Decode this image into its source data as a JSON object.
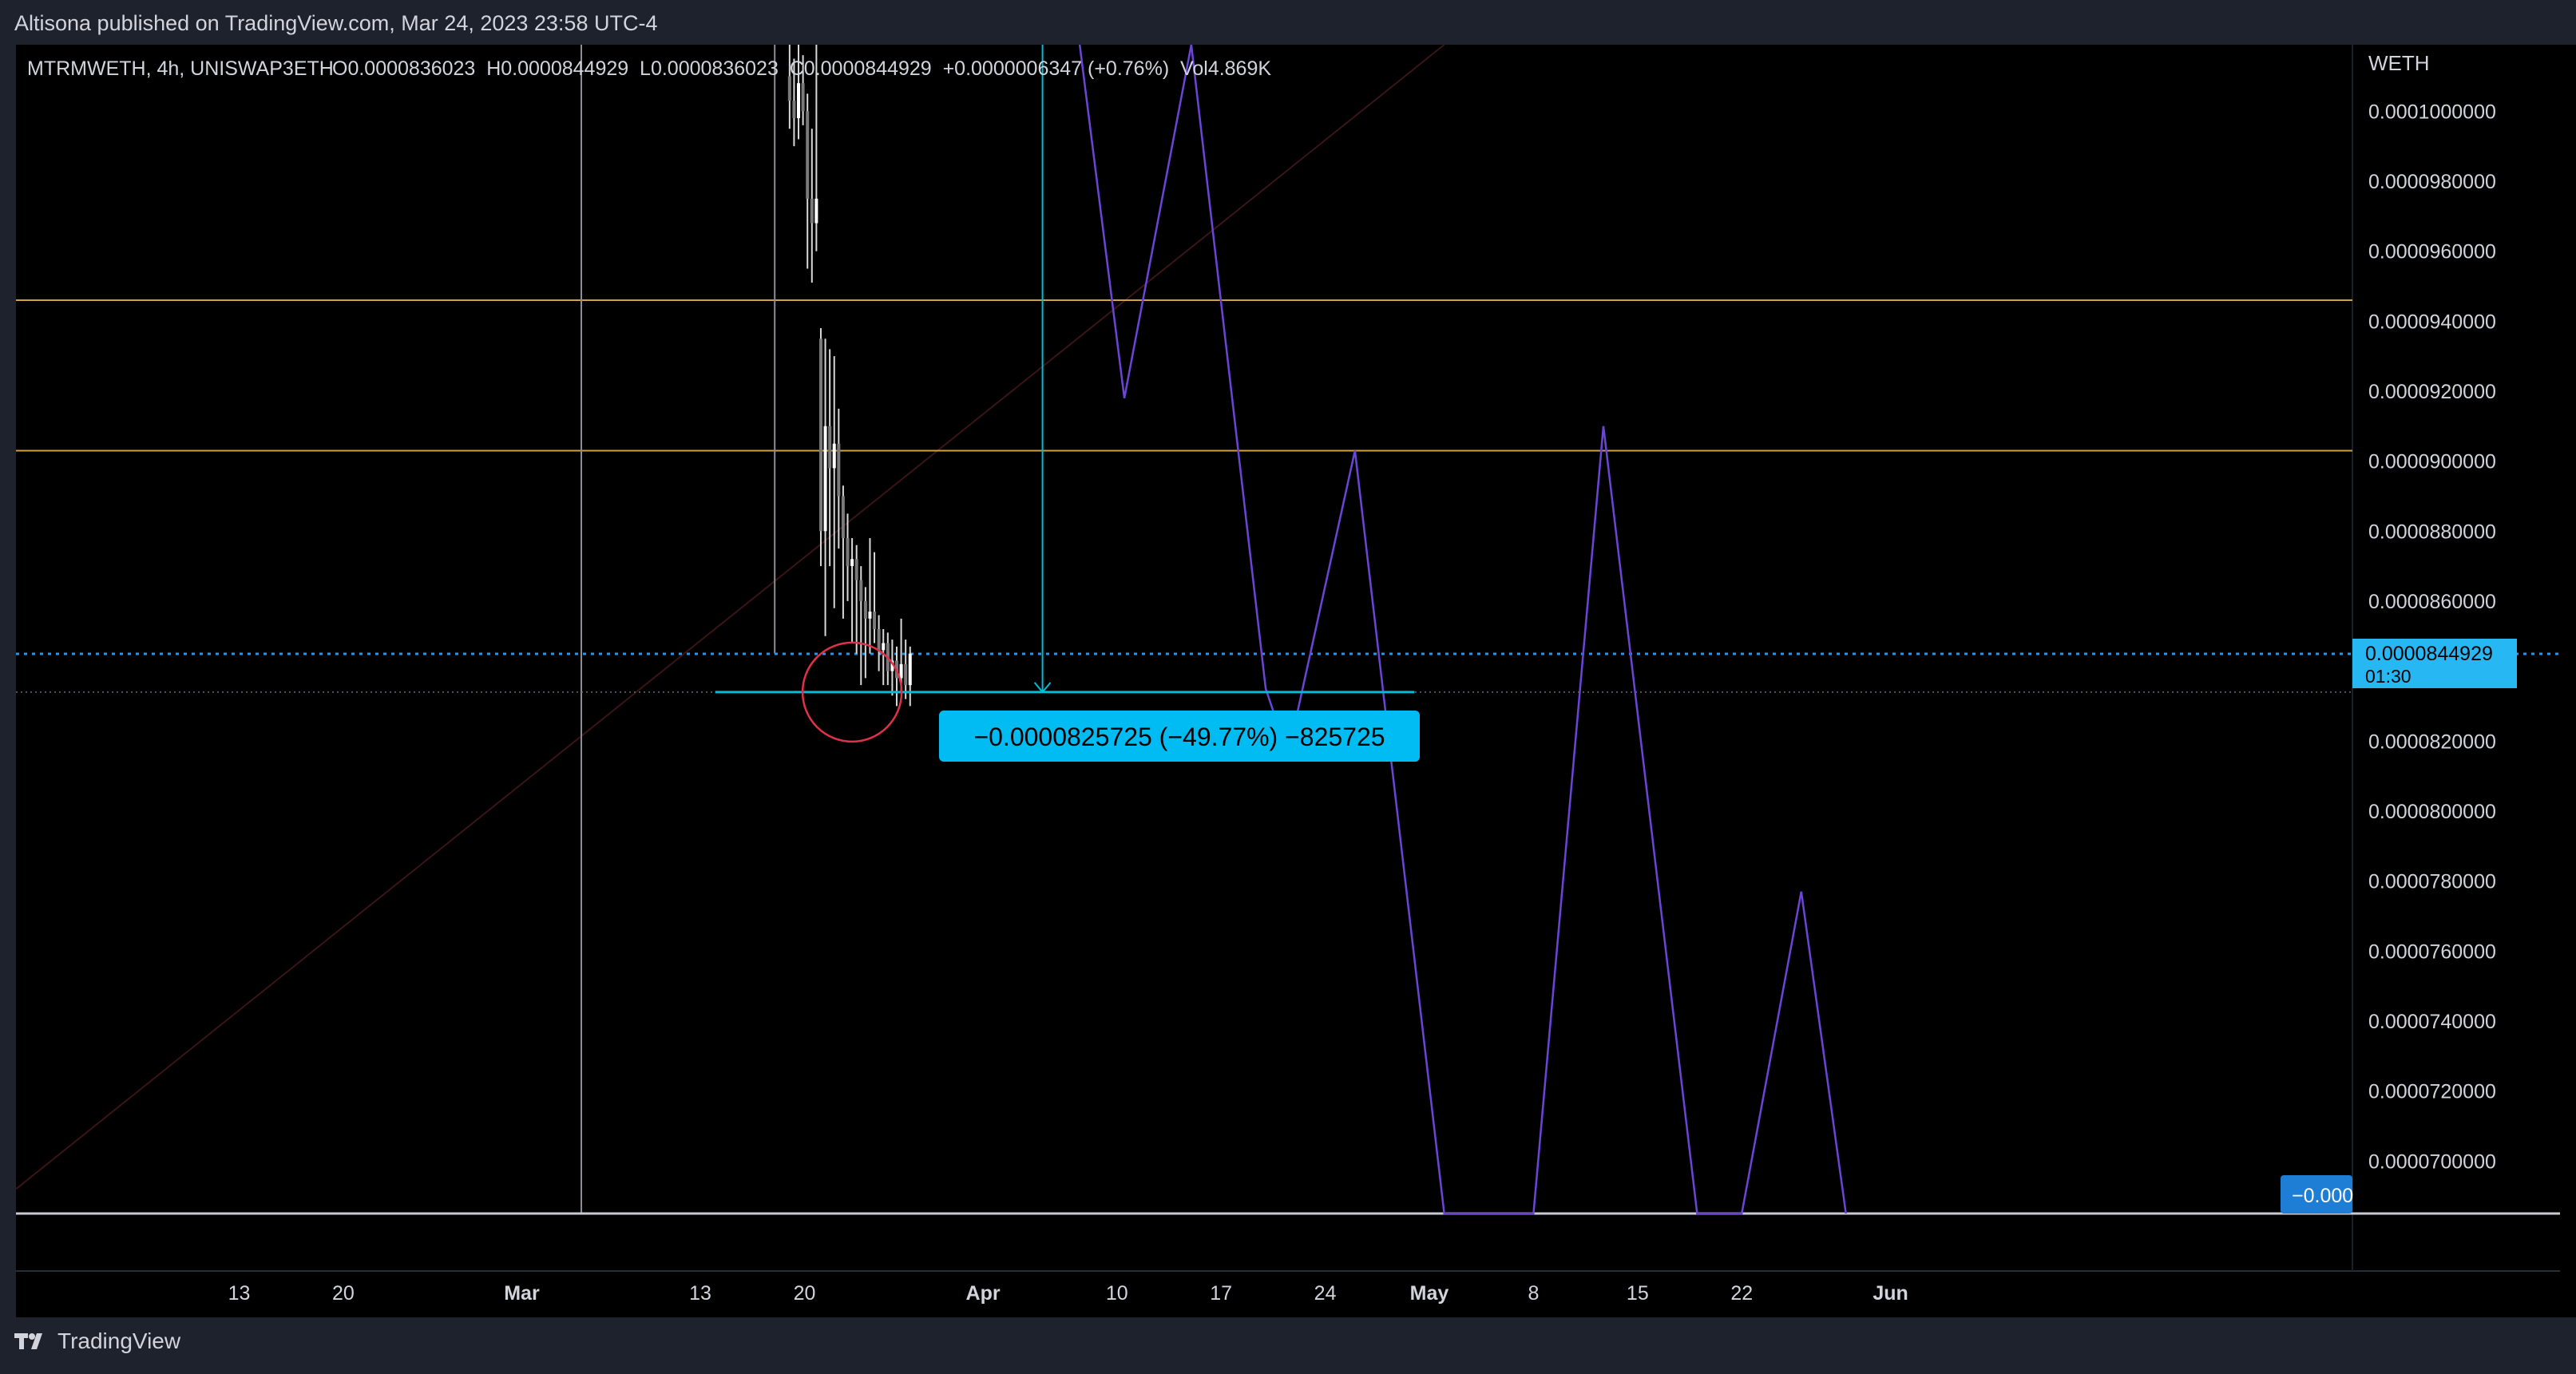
{
  "header": {
    "publish_line": "Altisona published on TradingView.com, Mar 24, 2023 23:58 UTC-4"
  },
  "legend": {
    "symbol": "MTRMWETH, 4h, UNISWAP3ETH",
    "ohlc": "O0.0000836023  H0.0000844929  L0.0000836023  C0.0000844929  +0.0000006347 (+0.76%)  Vol4.869K"
  },
  "footer": {
    "brand": "TradingView",
    "logo_icon": "tradingview-logo-icon"
  },
  "chart_data": {
    "type": "candlestick",
    "y_unit": "WETH",
    "ylim": [
      6.85e-05,
      0.0001019
    ],
    "y_ticks": [
      "0.0001000000",
      "0.0000980000",
      "0.0000960000",
      "0.0000940000",
      "0.0000920000",
      "0.0000900000",
      "0.0000880000",
      "0.0000860000",
      "0.0000820000",
      "0.0000800000",
      "0.0000780000",
      "0.0000760000",
      "0.0000740000",
      "0.0000720000",
      "0.0000700000"
    ],
    "x_day_range": [
      -34,
      137
    ],
    "x_ticks": [
      {
        "label": "13",
        "day": -19
      },
      {
        "label": "20",
        "day": -12
      },
      {
        "label": "Mar",
        "day": 0
      },
      {
        "label": "13",
        "day": 12
      },
      {
        "label": "20",
        "day": 19
      },
      {
        "label": "Apr",
        "day": 31
      },
      {
        "label": "10",
        "day": 40
      },
      {
        "label": "17",
        "day": 47
      },
      {
        "label": "24",
        "day": 54
      },
      {
        "label": "May",
        "day": 61
      },
      {
        "label": "8",
        "day": 68
      },
      {
        "label": "15",
        "day": 75
      },
      {
        "label": "22",
        "day": 82
      },
      {
        "label": "Jun",
        "day": 92
      }
    ],
    "price_label": {
      "value": "0.0000844929",
      "countdown": "01:30",
      "price": 8.44929e-05
    },
    "bottom_badge": "−0.000",
    "measure_label": "−0.0000825725 (−49.77%) −825725",
    "candles": [
      {
        "x": 18.0,
        "o": 0.000101,
        "c": 0.0001003,
        "h": 0.0001019,
        "l": 9.95e-05
      },
      {
        "x": 18.3,
        "o": 0.0001003,
        "c": 9.98e-05,
        "h": 0.0001015,
        "l": 9.9e-05
      },
      {
        "x": 18.6,
        "o": 9.98e-05,
        "c": 0.0001008,
        "h": 0.0001019,
        "l": 9.92e-05
      },
      {
        "x": 18.9,
        "o": 0.0001008,
        "c": 0.0001,
        "h": 0.0001016,
        "l": 9.96e-05
      },
      {
        "x": 19.2,
        "o": 0.0001,
        "c": 9.75e-05,
        "h": 0.0001005,
        "l": 9.55e-05
      },
      {
        "x": 19.5,
        "o": 9.75e-05,
        "c": 9.68e-05,
        "h": 9.95e-05,
        "l": 9.51e-05
      },
      {
        "x": 19.8,
        "o": 9.68e-05,
        "c": 9.75e-05,
        "h": 0.0001019,
        "l": 9.6e-05
      },
      {
        "x": 20.1,
        "o": 9.35e-05,
        "c": 8.8e-05,
        "h": 9.38e-05,
        "l": 8.7e-05
      },
      {
        "x": 20.4,
        "o": 8.8e-05,
        "c": 9.1e-05,
        "h": 9.35e-05,
        "l": 8.5e-05
      },
      {
        "x": 20.7,
        "o": 9.1e-05,
        "c": 8.98e-05,
        "h": 9.32e-05,
        "l": 8.7e-05
      },
      {
        "x": 21.0,
        "o": 8.98e-05,
        "c": 9.05e-05,
        "h": 9.3e-05,
        "l": 8.58e-05
      },
      {
        "x": 21.3,
        "o": 9.05e-05,
        "c": 8.9e-05,
        "h": 9.15e-05,
        "l": 8.75e-05
      },
      {
        "x": 21.6,
        "o": 8.9e-05,
        "c": 8.78e-05,
        "h": 8.93e-05,
        "l": 8.55e-05
      },
      {
        "x": 21.9,
        "o": 8.78e-05,
        "c": 8.7e-05,
        "h": 8.85e-05,
        "l": 8.6e-05
      },
      {
        "x": 22.2,
        "o": 8.7e-05,
        "c": 8.72e-05,
        "h": 8.78e-05,
        "l": 8.48e-05
      },
      {
        "x": 22.5,
        "o": 8.72e-05,
        "c": 8.66e-05,
        "h": 8.76e-05,
        "l": 8.45e-05
      },
      {
        "x": 22.8,
        "o": 8.66e-05,
        "c": 8.6e-05,
        "h": 8.7e-05,
        "l": 8.36e-05
      },
      {
        "x": 23.1,
        "o": 8.6e-05,
        "c": 8.55e-05,
        "h": 8.64e-05,
        "l": 8.38e-05
      },
      {
        "x": 23.4,
        "o": 8.55e-05,
        "c": 8.57e-05,
        "h": 8.78e-05,
        "l": 8.45e-05
      },
      {
        "x": 23.7,
        "o": 8.57e-05,
        "c": 8.52e-05,
        "h": 8.74e-05,
        "l": 8.48e-05
      },
      {
        "x": 24.0,
        "o": 8.52e-05,
        "c": 8.46e-05,
        "h": 8.56e-05,
        "l": 8.4e-05
      },
      {
        "x": 24.3,
        "o": 8.46e-05,
        "c": 8.48e-05,
        "h": 8.52e-05,
        "l": 8.36e-05
      },
      {
        "x": 24.6,
        "o": 8.48e-05,
        "c": 8.4e-05,
        "h": 8.51e-05,
        "l": 8.36e-05
      },
      {
        "x": 24.9,
        "o": 8.4e-05,
        "c": 8.43e-05,
        "h": 8.49e-05,
        "l": 8.33e-05
      },
      {
        "x": 25.2,
        "o": 8.43e-05,
        "c": 8.38e-05,
        "h": 8.47e-05,
        "l": 8.3e-05
      },
      {
        "x": 25.5,
        "o": 8.38e-05,
        "c": 8.42e-05,
        "h": 8.55e-05,
        "l": 8.34e-05
      },
      {
        "x": 25.8,
        "o": 8.42e-05,
        "c": 8.36e-05,
        "h": 8.49e-05,
        "l": 8.32e-05
      },
      {
        "x": 26.1,
        "o": 8.36e-05,
        "c": 8.45e-05,
        "h": 8.47e-05,
        "l": 8.3e-05
      }
    ],
    "drawings": {
      "horizontal_lines": [
        {
          "name": "resistance-line-upper",
          "price": 9.46e-05,
          "color": "#d1a23f"
        },
        {
          "name": "resistance-line-lower",
          "price": 9.03e-05,
          "color": "#d1a23f"
        }
      ],
      "vertical_lines": [
        {
          "name": "vertical-line-early-march",
          "day": 4,
          "color": "#8a8d96"
        },
        {
          "name": "vertical-line-mid-march",
          "day": 17,
          "color": "#8a8d96",
          "price_top": 0.0001019,
          "price_bottom": 8.45e-05
        }
      ],
      "trend_line": {
        "start": {
          "day": -34,
          "price": 6.92e-05
        },
        "end": {
          "day": 62,
          "price": 0.0001019
        },
        "color": "#3a1518"
      },
      "projection_path": {
        "color": "#6c44d8",
        "points": [
          {
            "day": 37.5,
            "price": 0.0001019
          },
          {
            "day": 40.5,
            "price": 9.18e-05
          },
          {
            "day": 45,
            "price": 0.0001019
          },
          {
            "day": 50,
            "price": 8.35e-05
          },
          {
            "day": 51.5,
            "price": 8.16e-05
          },
          {
            "day": 56,
            "price": 9.03e-05
          },
          {
            "day": 62,
            "price": 6.85e-05
          },
          {
            "day": 68,
            "price": 6.85e-05
          },
          {
            "day": 72.7,
            "price": 9.1e-05
          },
          {
            "day": 79,
            "price": 6.85e-05
          },
          {
            "day": 82,
            "price": 6.85e-05
          },
          {
            "day": 86,
            "price": 7.77e-05
          },
          {
            "day": 89,
            "price": 6.85e-05
          }
        ]
      },
      "measure_tool": {
        "color": "#00bcd4",
        "day": 35,
        "day_start": 13,
        "day_end": 60,
        "price_top": 0.0001019,
        "price_bottom": 8.34e-05
      },
      "circle_marker": {
        "day": 22.2,
        "price": 8.34e-05,
        "color": "#e0304a"
      },
      "current_price_line": {
        "price": 8.44929e-05,
        "color": "#2196f3"
      },
      "low_dotted_line": {
        "price": 8.34e-05,
        "color": "#6a6d78"
      }
    }
  }
}
